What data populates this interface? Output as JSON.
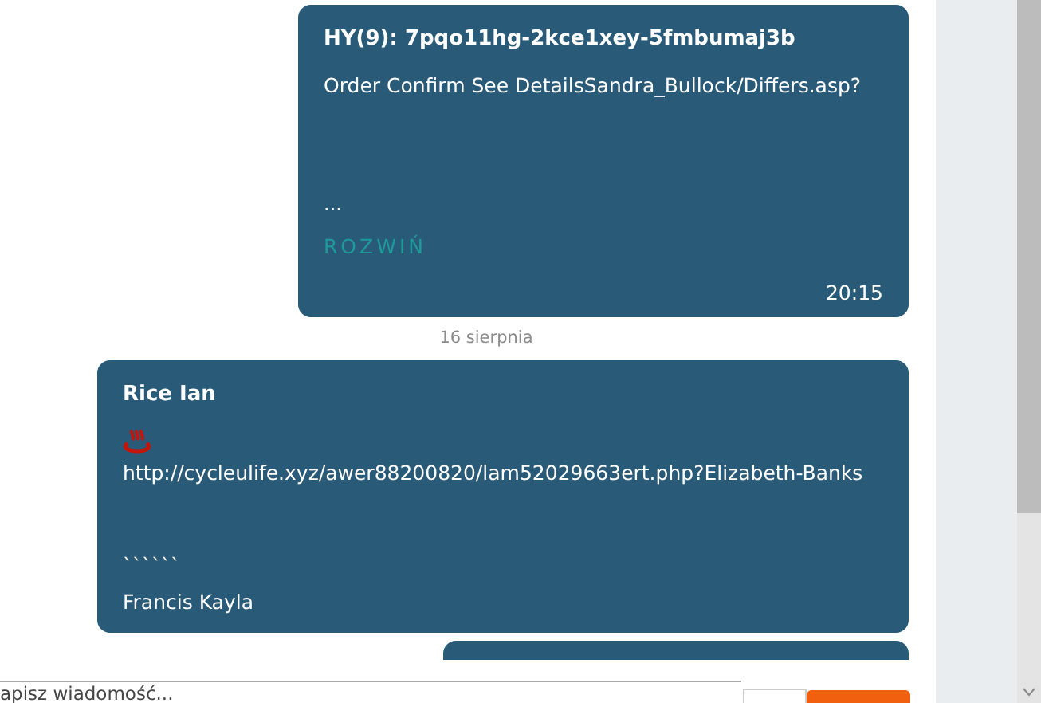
{
  "messages": [
    {
      "outgoing": true,
      "sender": "HY(9): 7pqo11hg-2kce1xey-5fmbumaj3b",
      "lines": [
        {
          "kind": "text",
          "text": "Order Confirm See DetailsSandra_Bullock/Differs.asp?"
        },
        {
          "kind": "ellipsis",
          "text": "..."
        },
        {
          "kind": "expand",
          "text": "ROZWIŃ"
        }
      ],
      "time": "20:15"
    },
    {
      "kind": "date",
      "text": "16 sierpnia"
    },
    {
      "outgoing": false,
      "sender": "Rice Ian",
      "lines": [
        {
          "kind": "emoji"
        },
        {
          "kind": "text",
          "text": "http://cycleulife.xyz/awer88200820/lam52029663ert.php?Elizabeth-Banks"
        },
        {
          "kind": "ellipsis",
          "text": "``````"
        },
        {
          "kind": "text",
          "text": "Francis Kayla"
        }
      ]
    }
  ],
  "composer": {
    "placeholder": "apisz wiadomość..."
  }
}
